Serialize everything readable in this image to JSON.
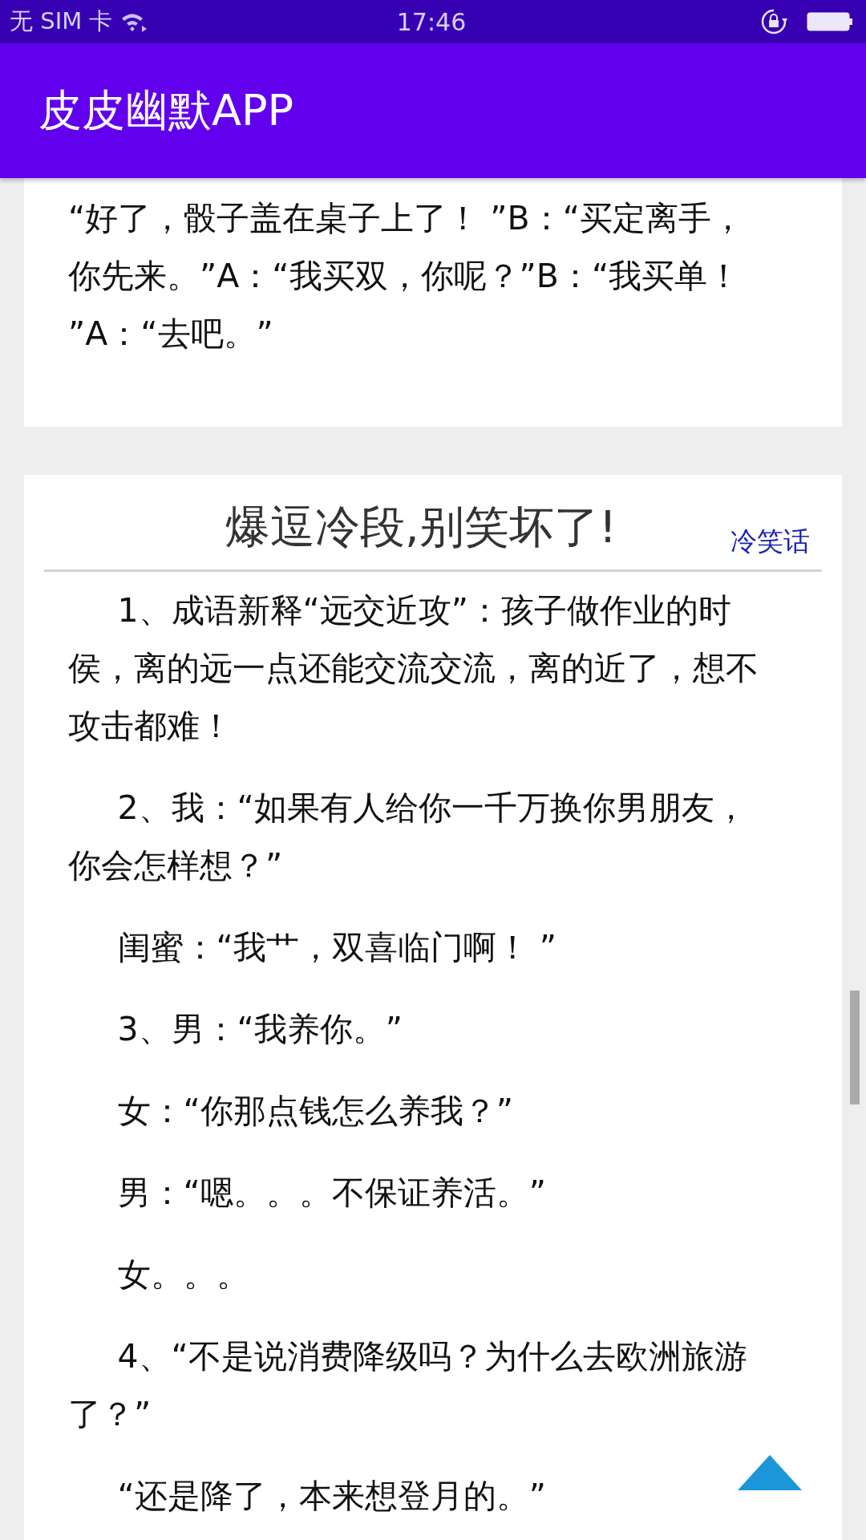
{
  "status_bar": {
    "carrier": "无 SIM 卡",
    "time": "17:46"
  },
  "app_bar": {
    "title": "皮皮幽默APP"
  },
  "cards": [
    {
      "paragraphs": [
        "“好了，骰子盖在桌子上了！ ”B：“买定离手，你先来。”A：“我买双，你呢？”B：“我买单！ ”A：“去吧。”"
      ]
    },
    {
      "title": "爆逗冷段,别笑坏了!",
      "tag": "冷笑话",
      "paragraphs": [
        "1、成语新释“远交近攻”：孩子做作业的时侯，离的远一点还能交流交流，离的近了，想不攻击都难！",
        "2、我：“如果有人给你一千万换你男朋友，你会怎样想？”",
        "闺蜜：“我艹，双喜临门啊！ ”",
        "3、男：“我养你。”",
        "女：“你那点钱怎么养我？”",
        "男：“嗯。。。不保证养活。”",
        "女。。。",
        "4、“不是说消费降级吗？为什么去欧洲旅游了？”",
        "“还是降了，本来想登月的。”"
      ]
    }
  ]
}
